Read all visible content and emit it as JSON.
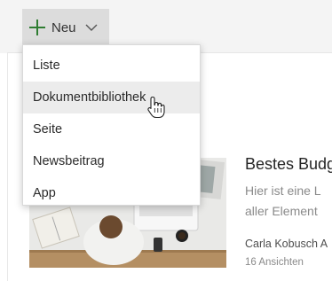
{
  "toolbar": {
    "new_label": "Neu",
    "new_icon": "plus-icon",
    "dropdown_icon": "chevron-down-icon",
    "accent": "#2f7d32"
  },
  "menu": {
    "items": [
      {
        "label": "Liste"
      },
      {
        "label": "Dokumentbibliothek",
        "hovered": true
      },
      {
        "label": "Seite"
      },
      {
        "label": "Newsbeitrag"
      },
      {
        "label": "App"
      }
    ]
  },
  "news": {
    "title": "Bestes Budg",
    "description_line1": "Hier ist eine L",
    "description_line2": "aller Element",
    "author": "Carla Kobusch A",
    "views": "16 Ansichten"
  }
}
